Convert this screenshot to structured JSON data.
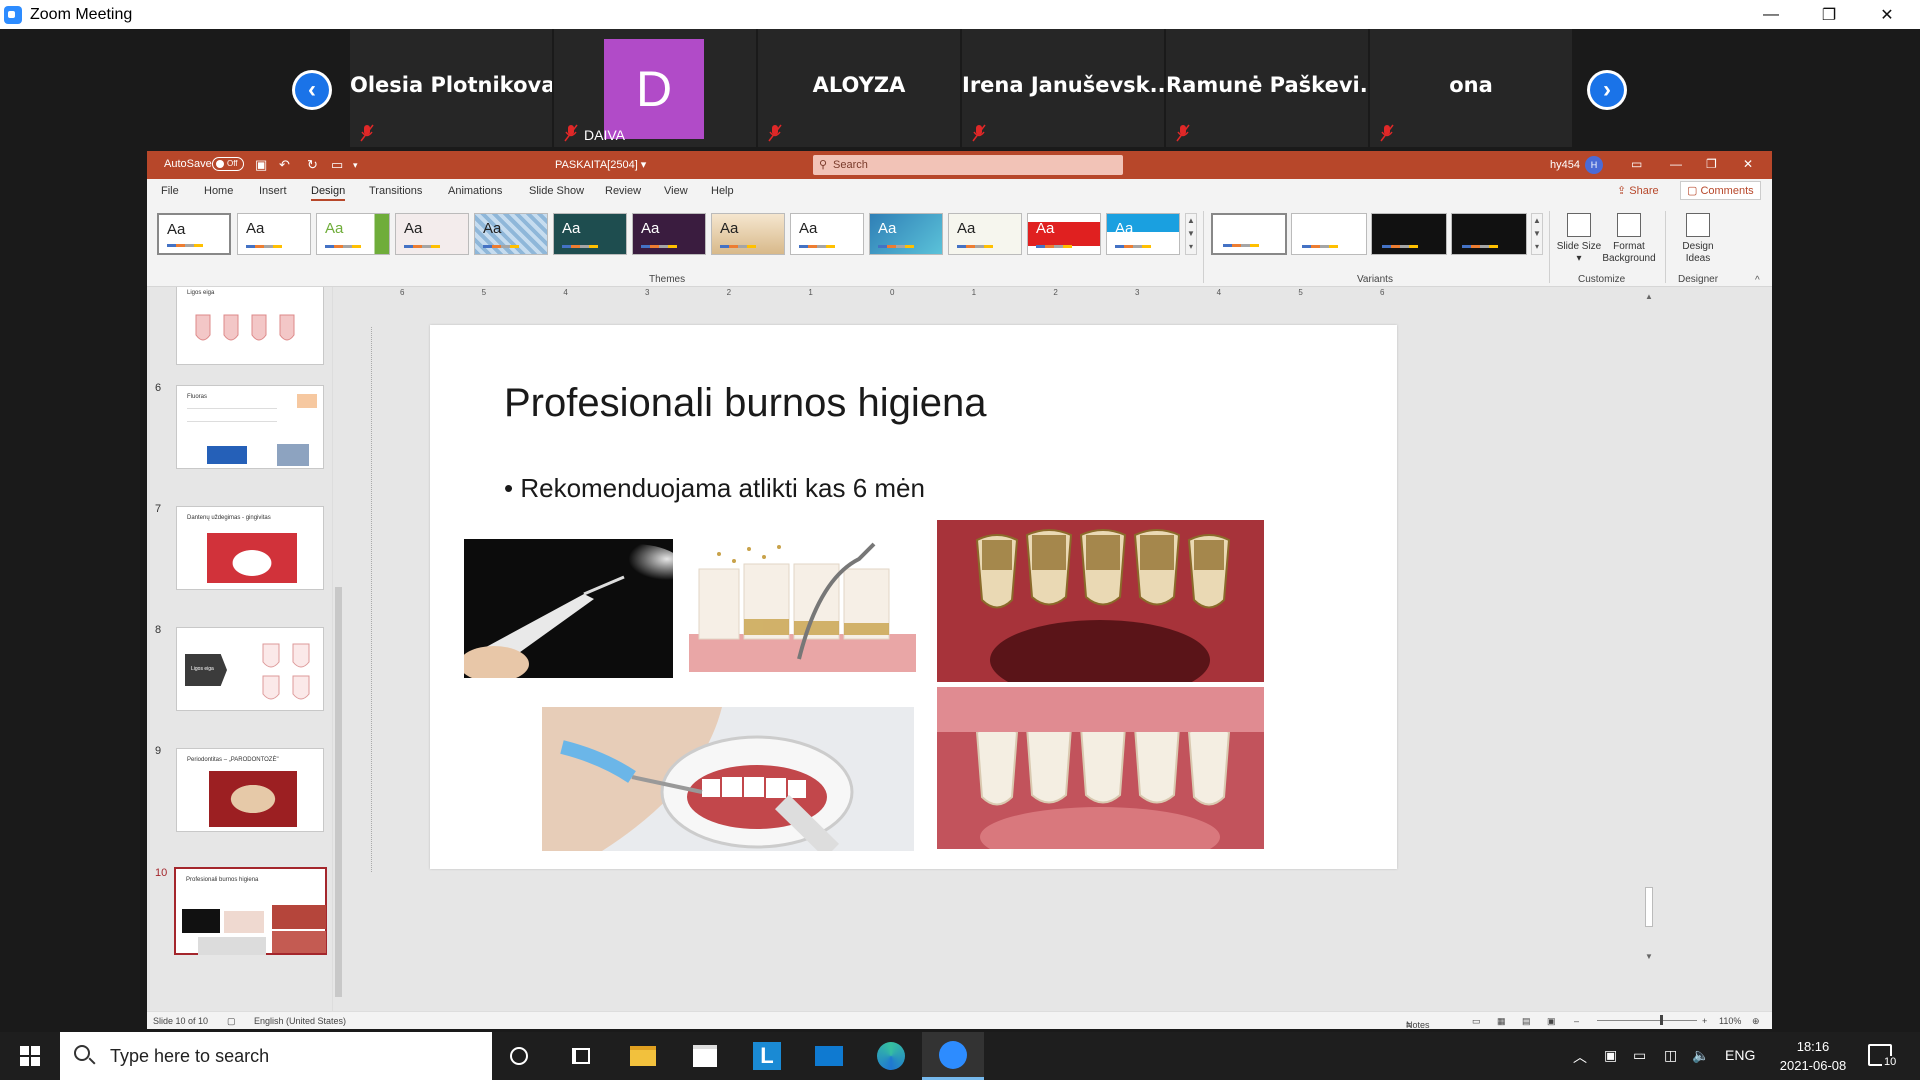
{
  "zoom": {
    "title": "Zoom Meeting",
    "window_controls": {
      "minimize": "—",
      "restore": "❐",
      "close": "✕"
    },
    "participants": [
      {
        "name": "Olesia Plotnikova"
      },
      {
        "name": "DAIVA",
        "initial": "D"
      },
      {
        "name": "ALOYZA"
      },
      {
        "name": "Irena  Januševsk..."
      },
      {
        "name": "Ramunė  Paškevi..."
      },
      {
        "name": "ona"
      }
    ]
  },
  "ppt": {
    "autosave_label": "AutoSave",
    "autosave_state": "Off",
    "doc_name": "PASKAITA[2504]  ▾",
    "search_placeholder": "Search",
    "user": "hy454",
    "user_initial": "H",
    "tabs": [
      "File",
      "Home",
      "Insert",
      "Design",
      "Transitions",
      "Animations",
      "Slide Show",
      "Review",
      "View",
      "Help"
    ],
    "active_tab": "Design",
    "share_label": "Share",
    "comments_label": "Comments",
    "ribbon": {
      "themes_label": "Themes",
      "variants_label": "Variants",
      "customize_label": "Customize",
      "designer_label": "Designer",
      "theme_glyph": "Aa",
      "slide_size": "Slide Size ▾",
      "format_background": "Format Background",
      "design_ideas": "Design Ideas"
    },
    "thumbnails": [
      {
        "num": "",
        "title": "Ligos eiga"
      },
      {
        "num": "6",
        "title": "Fluoras"
      },
      {
        "num": "7",
        "title": "Dantenų uždegimas - gingivitas"
      },
      {
        "num": "8",
        "title": "Ligos eiga"
      },
      {
        "num": "9",
        "title": "Periodontitas – „PARODONTOZĖ\""
      },
      {
        "num": "10",
        "title": "Profesionali burnos higiena"
      }
    ],
    "slide": {
      "title": "Profesionali burnos higiena",
      "bullet": "Rekomenduojama atlikti kas 6 mėn"
    },
    "ruler_ticks": [
      "6",
      "5",
      "4",
      "3",
      "2",
      "1",
      "0",
      "1",
      "2",
      "3",
      "4",
      "5",
      "6"
    ],
    "status": {
      "slide_counter": "Slide 10 of 10",
      "language": "English (United States)",
      "notes": "Notes",
      "zoom": "110%"
    }
  },
  "taskbar": {
    "search_placeholder": "Type here to search",
    "language": "ENG",
    "time": "18:16",
    "date": "2021-06-08",
    "notifications": "10"
  },
  "colors": {
    "ppt_accent": "#b7472a",
    "zoom_blue": "#1a73e8",
    "avatar_purple": "#b14bc8"
  }
}
